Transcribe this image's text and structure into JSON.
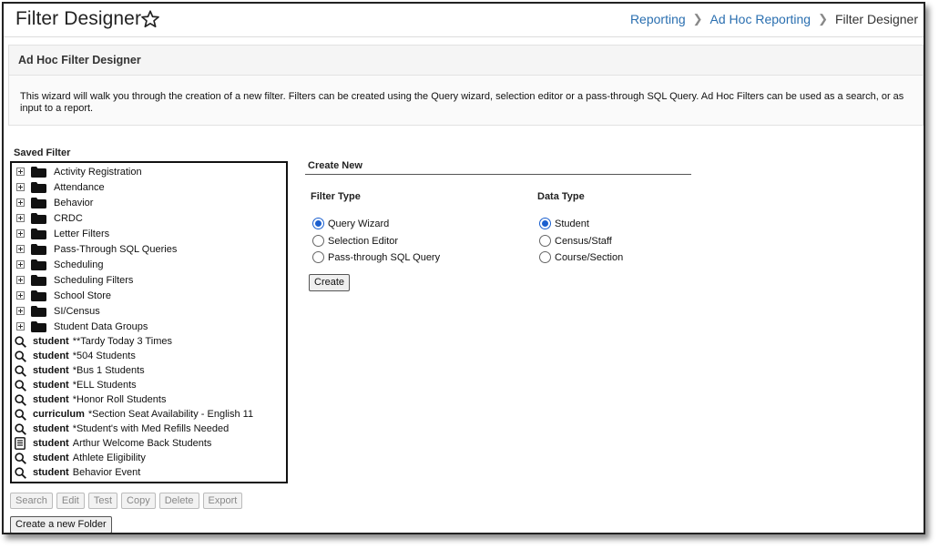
{
  "header": {
    "title": "Filter Designer",
    "breadcrumb": [
      "Reporting",
      "Ad Hoc Reporting",
      "Filter Designer"
    ]
  },
  "intro": {
    "title": "Ad Hoc Filter Designer",
    "text": "This wizard will walk you through the creation of a new filter. Filters can be created using the Query wizard, selection editor or a pass-through SQL Query. Ad Hoc Filters can be used as a search, or as input to a report."
  },
  "saved_filter": {
    "label": "Saved Filter",
    "folders": [
      "Activity Registration",
      "Attendance",
      "Behavior",
      "CRDC",
      "Letter Filters",
      "Pass-Through SQL Queries",
      "Scheduling",
      "Scheduling Filters",
      "School Store",
      "SI/Census",
      "Student Data Groups"
    ],
    "filters": [
      {
        "type": "student",
        "name": "**Tardy Today 3 Times",
        "icon": "magnifier-icon"
      },
      {
        "type": "student",
        "name": "*504 Students",
        "icon": "magnifier-icon"
      },
      {
        "type": "student",
        "name": "*Bus 1 Students",
        "icon": "magnifier-icon"
      },
      {
        "type": "student",
        "name": "*ELL Students",
        "icon": "magnifier-icon"
      },
      {
        "type": "student",
        "name": "*Honor Roll Students",
        "icon": "magnifier-icon"
      },
      {
        "type": "curriculum",
        "name": "*Section Seat Availability - English 11",
        "icon": "magnifier-icon"
      },
      {
        "type": "student",
        "name": "*Student's with Med Refills Needed",
        "icon": "magnifier-icon"
      },
      {
        "type": "student",
        "name": "Arthur Welcome Back Students",
        "icon": "document-icon"
      },
      {
        "type": "student",
        "name": "Athlete Eligibility",
        "icon": "magnifier-icon"
      },
      {
        "type": "student",
        "name": "Behavior Event",
        "icon": "magnifier-icon"
      }
    ],
    "buttons": [
      "Search",
      "Edit",
      "Test",
      "Copy",
      "Delete",
      "Export"
    ],
    "new_folder_label": "Create a new Folder"
  },
  "create_new": {
    "title": "Create New",
    "filter_type": {
      "label": "Filter Type",
      "options": [
        "Query Wizard",
        "Selection Editor",
        "Pass-through SQL Query"
      ],
      "selected": "Query Wizard"
    },
    "data_type": {
      "label": "Data Type",
      "options": [
        "Student",
        "Census/Staff",
        "Course/Section"
      ],
      "selected": "Student"
    },
    "create_label": "Create"
  },
  "colors": {
    "link": "#2a6fb0",
    "radio_accent": "#1a5fcf"
  }
}
